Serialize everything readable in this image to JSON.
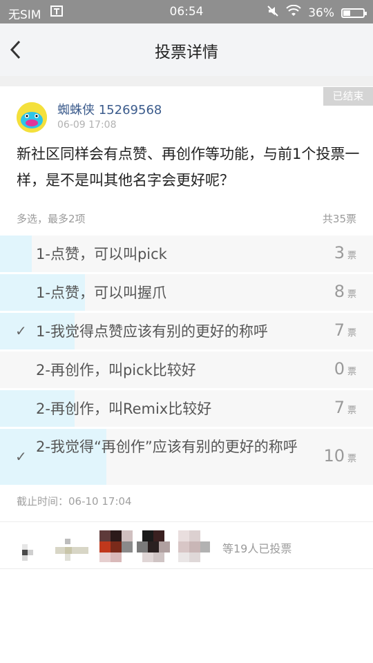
{
  "status_bar": {
    "carrier": "无SIM",
    "time": "06:54",
    "battery": "36%",
    "battery_level": 0.36
  },
  "nav": {
    "title": "投票详情",
    "back_icon": "chevron-left-icon"
  },
  "post": {
    "badge": "已结束",
    "author_name": "蜘蛛侠",
    "author_id": "15269568",
    "time": "06-09 17:08",
    "question": "新社区同样会有点赞、再创作等功能，与前1个投票一样，是不是叫其他名字会更好呢？",
    "mode": "多选，最多2项",
    "total": "共35票",
    "deadline": "截止时间：06-10 17:04"
  },
  "options": [
    {
      "label": "1-点赞，可以叫pick",
      "count": "3",
      "unit": "票",
      "checked": false,
      "share": 0.0857
    },
    {
      "label": "1-点赞，可以叫握爪",
      "count": "8",
      "unit": "票",
      "checked": false,
      "share": 0.2286
    },
    {
      "label": "1-我觉得点赞应该有别的更好的称呼",
      "count": "7",
      "unit": "票",
      "checked": true,
      "share": 0.2
    },
    {
      "label": "2-再创作，叫pick比较好",
      "count": "0",
      "unit": "票",
      "checked": false,
      "share": 0
    },
    {
      "label": "2-再创作，叫Remix比较好",
      "count": "7",
      "unit": "票",
      "checked": false,
      "share": 0.2
    },
    {
      "label": "2-我觉得“再创作”应该有别的更好的称呼",
      "count": "10",
      "unit": "票",
      "checked": true,
      "share": 0.2857
    }
  ],
  "voters": {
    "text": "等19人已投票",
    "avatars": [
      "voter-avatar-1",
      "voter-avatar-2",
      "voter-avatar-3",
      "voter-avatar-4",
      "voter-avatar-5"
    ]
  },
  "colors": {
    "status_bar": "#8f8f8f",
    "bar_fill": "#e1f5fc",
    "author": "#3b5b8c"
  }
}
